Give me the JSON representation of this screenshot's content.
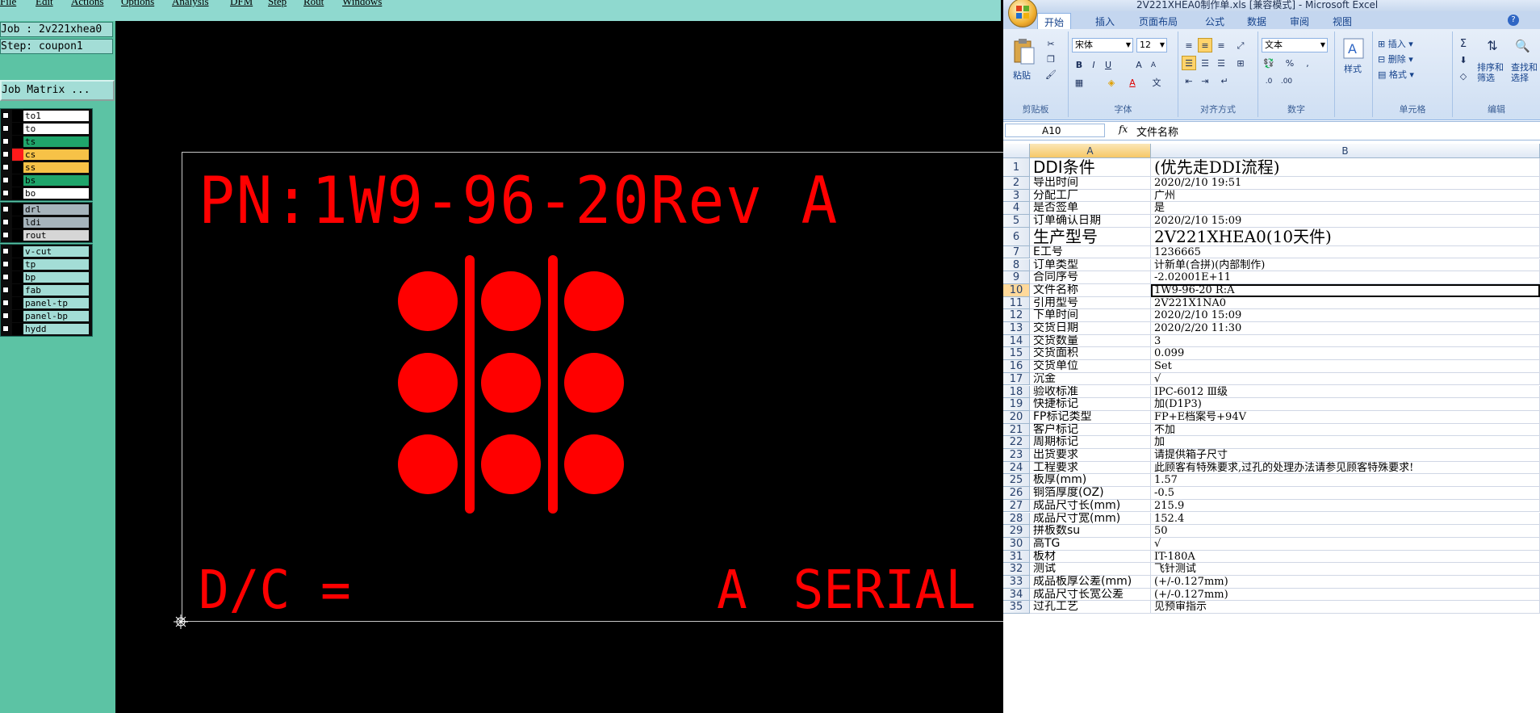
{
  "cam": {
    "menu": [
      "File",
      "Edit",
      "Actions",
      "Options",
      "Analysis",
      "DFM",
      "Step",
      "Rout",
      "Windows"
    ],
    "job_label": "Job : 2v221xhea0",
    "step_label": "Step: coupon1",
    "job_matrix_button": "Job Matrix ...",
    "layer_groups": [
      [
        {
          "name": "to1",
          "color": "#ffffff",
          "swatch": "#000000"
        },
        {
          "name": "to",
          "color": "#ffffff",
          "swatch": "#000000"
        },
        {
          "name": "ts",
          "color": "#1fa56b",
          "swatch": "#000000"
        },
        {
          "name": "cs",
          "color": "#f7c247",
          "swatch": "#ff1a1a",
          "active": true
        },
        {
          "name": "ss",
          "color": "#f7c247",
          "swatch": "#000000"
        },
        {
          "name": "bs",
          "color": "#1fa56b",
          "swatch": "#000000"
        },
        {
          "name": "bo",
          "color": "#ffffff",
          "swatch": "#000000"
        }
      ],
      [
        {
          "name": "drl",
          "color": "#a6b4bc",
          "swatch": "#000000"
        },
        {
          "name": "ldi",
          "color": "#a6b4bc",
          "swatch": "#000000"
        },
        {
          "name": "rout",
          "color": "#d6d6d6",
          "swatch": "#000000"
        }
      ],
      [
        {
          "name": "v-cut",
          "color": "#a3ddd6",
          "swatch": "#000000"
        },
        {
          "name": "tp",
          "color": "#a3ddd6",
          "swatch": "#000000"
        },
        {
          "name": "bp",
          "color": "#a3ddd6",
          "swatch": "#000000"
        },
        {
          "name": "fab",
          "color": "#a3ddd6",
          "swatch": "#000000"
        },
        {
          "name": "panel-tp",
          "color": "#a3ddd6",
          "swatch": "#000000"
        },
        {
          "name": "panel-bp",
          "color": "#a3ddd6",
          "swatch": "#000000"
        },
        {
          "name": "hydd",
          "color": "#a3ddd6",
          "swatch": "#000000"
        }
      ]
    ],
    "pcb": {
      "part_number_text": "PN:1W9-96-20Rev A",
      "dc_text": "D/C =",
      "serial_text": "A SERIAL ="
    }
  },
  "excel": {
    "title": "2V221XHEA0制作单.xls [兼容模式] - Microsoft Excel",
    "tabs": [
      "开始",
      "插入",
      "页面布局",
      "公式",
      "数据",
      "审阅",
      "视图"
    ],
    "active_tab": "开始",
    "ribbon": {
      "paste": "粘贴",
      "clipboard": "剪贴板",
      "font_name": "宋体",
      "font_size": "12",
      "font_group": "字体",
      "align_group": "对齐方式",
      "number_format": "文本",
      "number_group": "数字",
      "styles": "样式",
      "insert": "插入",
      "delete": "删除",
      "format": "格式",
      "cells_group": "单元格",
      "sort_filter": "排序和筛选",
      "find_select": "查找和选择",
      "editing_group": "编辑"
    },
    "name_box": "A10",
    "formula_value": "文件名称",
    "columns": [
      "A",
      "B"
    ],
    "rows": [
      {
        "n": "1",
        "a": "DDI条件",
        "b": "(优先走DDI流程)",
        "big": true
      },
      {
        "n": "2",
        "a": "导出时间",
        "b": "2020/2/10 19:51"
      },
      {
        "n": "3",
        "a": "分配工厂",
        "b": "广州"
      },
      {
        "n": "4",
        "a": "是否签单",
        "b": "是"
      },
      {
        "n": "5",
        "a": "订单确认日期",
        "b": "2020/2/10 15:09"
      },
      {
        "n": "6",
        "a": "生产型号",
        "b": "2V221XHEA0(10天件)",
        "big": true
      },
      {
        "n": "7",
        "a": "E工号",
        "b": "1236665"
      },
      {
        "n": "8",
        "a": "订单类型",
        "b": "计新单(合拼)(内部制作)"
      },
      {
        "n": "9",
        "a": "合同序号",
        "b": "-2.02001E+11"
      },
      {
        "n": "10",
        "a": "文件名称",
        "b": "1W9-96-20 R:A",
        "selected": true
      },
      {
        "n": "11",
        "a": "引用型号",
        "b": "2V221X1NA0"
      },
      {
        "n": "12",
        "a": "下单时间",
        "b": "2020/2/10 15:09"
      },
      {
        "n": "13",
        "a": "交货日期",
        "b": "2020/2/20 11:30"
      },
      {
        "n": "14",
        "a": "交货数量",
        "b": "3"
      },
      {
        "n": "15",
        "a": "交货面积",
        "b": "0.099"
      },
      {
        "n": "16",
        "a": "交货单位",
        "b": "Set"
      },
      {
        "n": "17",
        "a": "沉金",
        "b": "√"
      },
      {
        "n": "18",
        "a": "验收标准",
        "b": "IPC-6012 Ⅲ级"
      },
      {
        "n": "19",
        "a": "快捷标记",
        "b": "加(D1P3)"
      },
      {
        "n": "20",
        "a": "FP标记类型",
        "b": "FP+E档案号+94V"
      },
      {
        "n": "21",
        "a": "客户标记",
        "b": "不加"
      },
      {
        "n": "22",
        "a": "周期标记",
        "b": "加"
      },
      {
        "n": "23",
        "a": "出货要求",
        "b": "请提供箱子尺寸"
      },
      {
        "n": "24",
        "a": "工程要求",
        "b": "此顾客有特殊要求,过孔的处理办法请参见顾客特殊要求!"
      },
      {
        "n": "25",
        "a": "板厚(mm)",
        "b": "1.57"
      },
      {
        "n": "26",
        "a": "铜箔厚度(OZ)",
        "b": "-0.5"
      },
      {
        "n": "27",
        "a": "成品尺寸长(mm)",
        "b": "215.9"
      },
      {
        "n": "28",
        "a": "成品尺寸宽(mm)",
        "b": "152.4"
      },
      {
        "n": "29",
        "a": "拼板数su",
        "b": "50"
      },
      {
        "n": "30",
        "a": "高TG",
        "b": "√"
      },
      {
        "n": "31",
        "a": "板材",
        "b": "IT-180A"
      },
      {
        "n": "32",
        "a": "测试",
        "b": "飞针测试"
      },
      {
        "n": "33",
        "a": "成品板厚公差(mm)",
        "b": "(+/-0.127mm)"
      },
      {
        "n": "34",
        "a": "成品尺寸长宽公差",
        "b": "(+/-0.127mm)"
      },
      {
        "n": "35",
        "a": "过孔工艺",
        "b": "见预审指示"
      }
    ]
  }
}
